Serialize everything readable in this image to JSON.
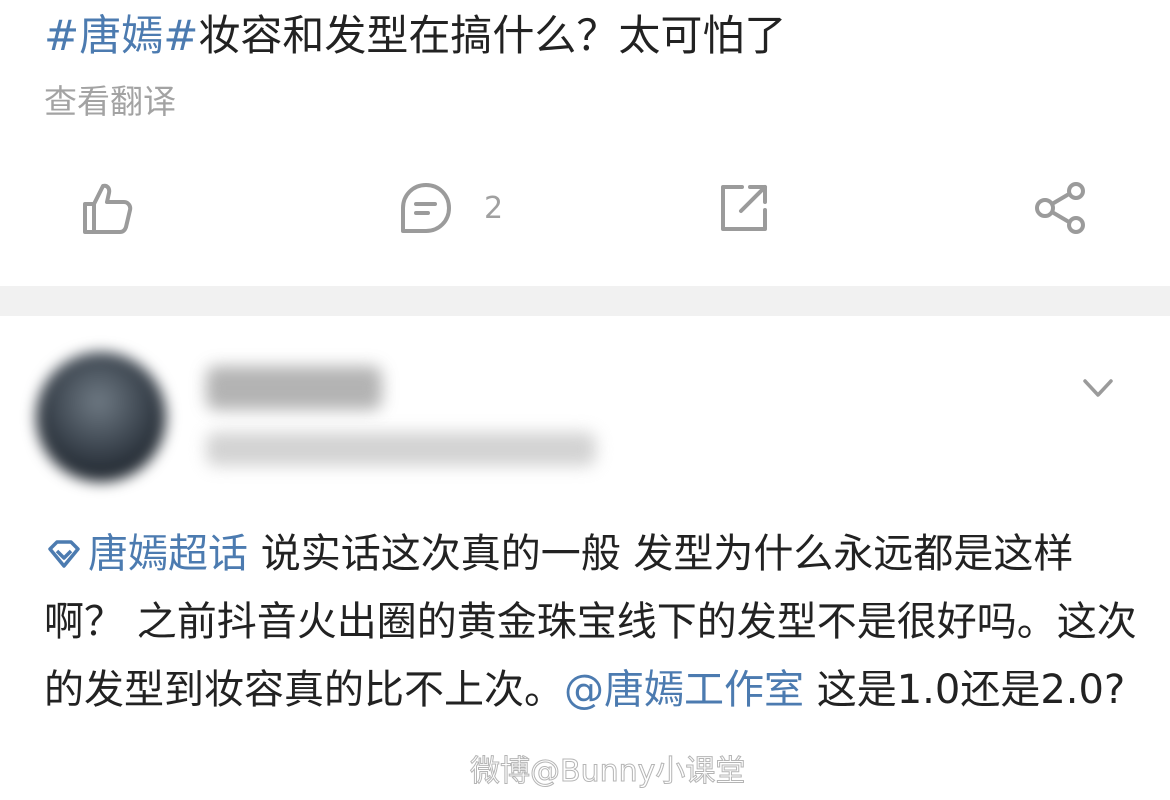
{
  "post": {
    "hashtag": "#唐嫣#",
    "text": "妆容和发型在搞什么？太可怕了",
    "translate_label": "查看翻译"
  },
  "actions": {
    "like_icon": "thumbs-up-icon",
    "comment_icon": "comment-bubble-icon",
    "comment_count": "2",
    "repost_icon": "repost-icon",
    "share_icon": "share-icon"
  },
  "comment": {
    "author_blurred": true,
    "expand_icon": "chevron-down-icon",
    "supertopic_icon": "diamond-icon",
    "supertopic_label": "唐嫣超话",
    "body_part1": " 说实话这次真的一般  发型为什么永远都是这样啊？ 之前抖音火出圈的黄金珠宝线下的发型不是很好吗。这次的发型到妆容真的比不上次。",
    "mention": "@唐嫣工作室",
    "body_part2": " 这是1.0还是2.0?"
  },
  "watermark": "微博@Bunny小课堂",
  "colors": {
    "link": "#4c7bb0",
    "text": "#222222",
    "muted": "#a3a3a3",
    "divider": "#f1f1f1"
  }
}
